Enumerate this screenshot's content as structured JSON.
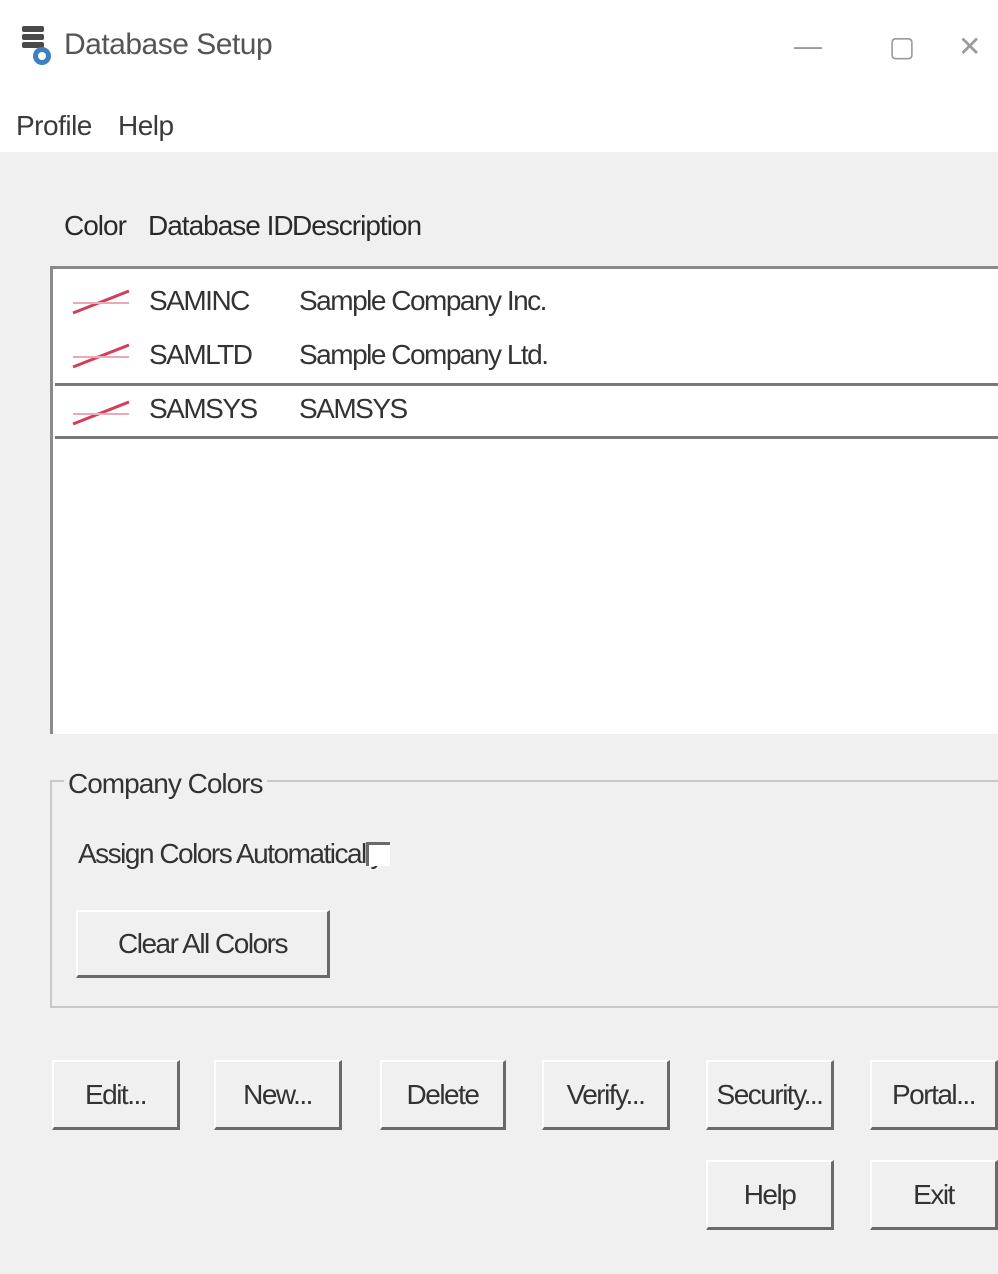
{
  "window": {
    "title": "Database Setup",
    "controls": {
      "minimize": "—",
      "maximize": "▢",
      "close": "✕"
    }
  },
  "menu": {
    "items": [
      "Profile",
      "Help"
    ]
  },
  "list": {
    "headers": [
      "Color",
      "Database ID",
      "Description"
    ],
    "rows": [
      {
        "color": "#d04058",
        "id": "SAMINC",
        "description": "Sample Company Inc."
      },
      {
        "color": "#d04058",
        "id": "SAMLTD",
        "description": "Sample Company Ltd."
      },
      {
        "color": "#d04058",
        "id": "SAMSYS",
        "description": "SAMSYS"
      }
    ],
    "selected_index": 2
  },
  "company_colors": {
    "legend": "Company Colors",
    "assign_label": "Assign Colors Automatically",
    "assign_checked": false,
    "clear_button": "Clear All Colors"
  },
  "buttons": {
    "edit": "Edit...",
    "new": "New...",
    "delete": "Delete",
    "verify": "Verify...",
    "security": "Security...",
    "portal": "Portal...",
    "help": "Help",
    "exit": "Exit"
  },
  "icons": {
    "app": "database-setup-icon",
    "swatch": "color-swatch-icon"
  }
}
